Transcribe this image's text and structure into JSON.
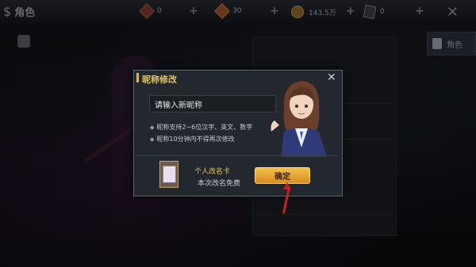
{
  "header": {
    "back_label": "角色",
    "resources": [
      {
        "name": "red-gem-icon",
        "value": "0"
      },
      {
        "name": "orange-gem-icon",
        "value": "30"
      },
      {
        "name": "gold-coin-icon",
        "value": "143.5万"
      },
      {
        "name": "card-icon",
        "value": "0"
      }
    ]
  },
  "side": {
    "role_tab_label": "角色"
  },
  "dialog": {
    "title": "昵称修改",
    "input_value": "请输入新昵称",
    "rules": [
      "昵称支持2~6位汉字、英文、数字",
      "昵称10分钟内不得再次修改"
    ],
    "item_name": "个人改名卡",
    "item_desc": "本次改名免费",
    "confirm_label": "确定"
  },
  "colors": {
    "accent": "#e0c36a",
    "confirm": "#f4c14a",
    "arrow": "#c52222"
  }
}
